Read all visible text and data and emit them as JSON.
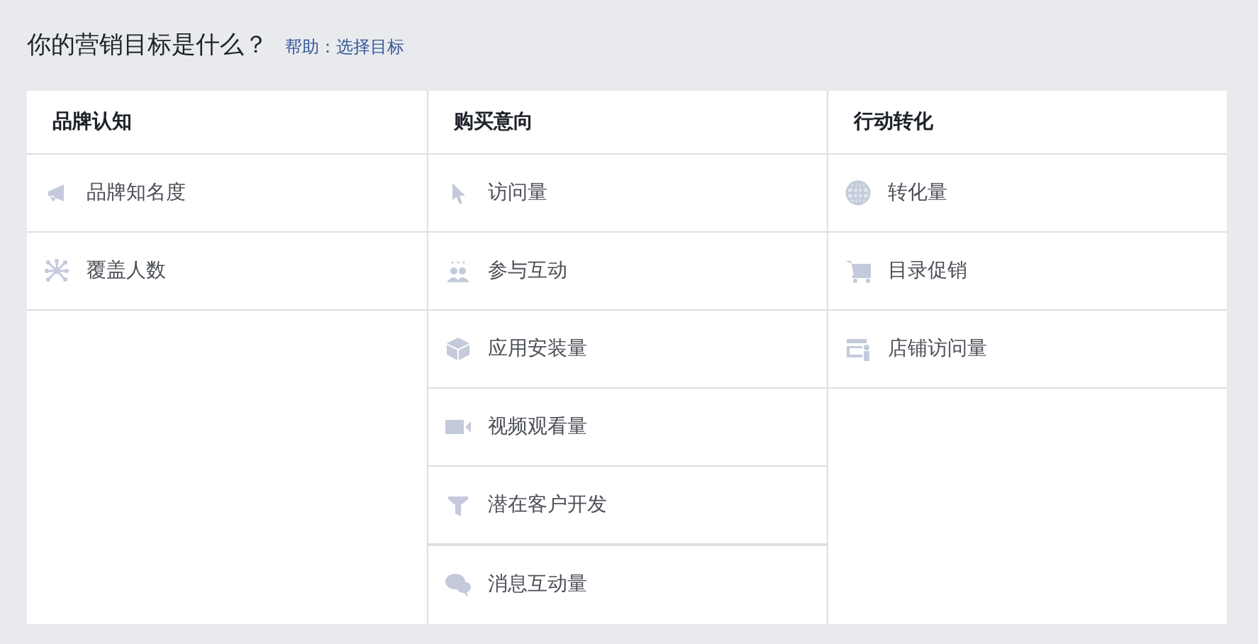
{
  "heading": {
    "title": "你的营销目标是什么？",
    "help_link": "帮助：选择目标"
  },
  "columns": [
    {
      "title": "品牌认知",
      "items": [
        "品牌知名度",
        "覆盖人数"
      ]
    },
    {
      "title": "购买意向",
      "items": [
        "访问量",
        "参与互动",
        "应用安装量",
        "视频观看量",
        "潜在客户开发",
        "消息互动量"
      ]
    },
    {
      "title": "行动转化",
      "items": [
        "转化量",
        "目录促销",
        "店铺访问量"
      ]
    }
  ]
}
